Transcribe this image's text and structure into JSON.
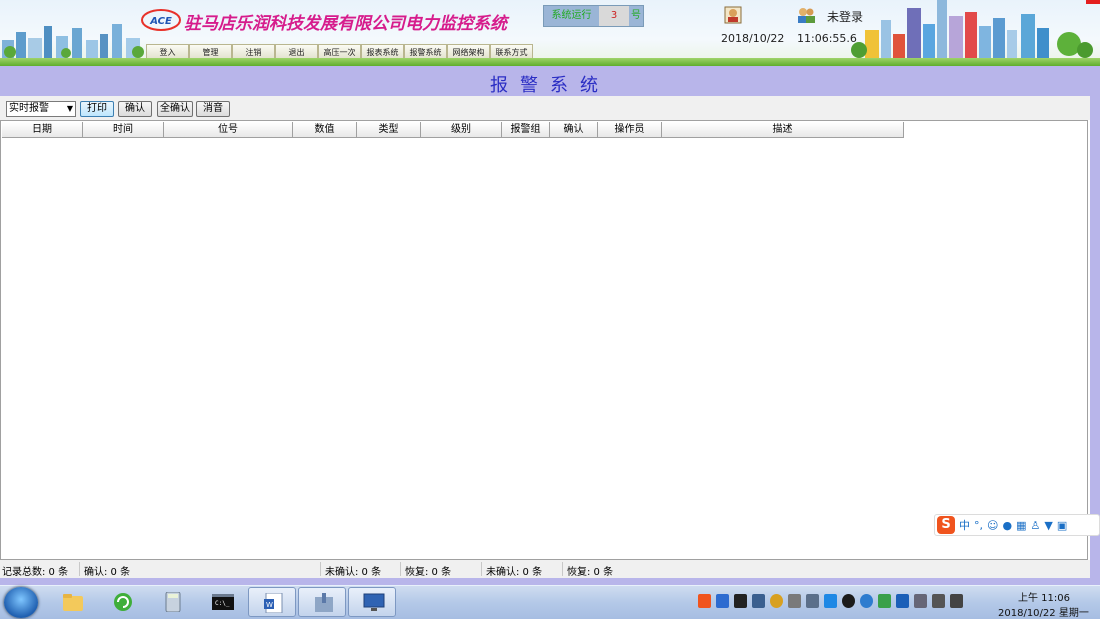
{
  "header": {
    "company_title": "驻马店乐润科技发展有限公司电力监控系统",
    "logo_text": "ACE",
    "nav": [
      {
        "label": "登入"
      },
      {
        "label": "管理"
      },
      {
        "label": "注销"
      },
      {
        "label": "退出"
      },
      {
        "label": "高压一次"
      },
      {
        "label": "报表系统"
      },
      {
        "label": "报警系统"
      },
      {
        "label": "网络架构"
      },
      {
        "label": "联系方式"
      }
    ],
    "status_label": "系统运行",
    "status_count": "3",
    "status_end": "号",
    "login_status": "未登录",
    "date": "2018/10/22",
    "time": "11:06:55.6"
  },
  "page_title": "报警系统",
  "toolbar": {
    "mode_selected": "实时报警",
    "print_label": "打印",
    "confirm_label": "确认",
    "confirm_all_label": "全确认",
    "mute_label": "消音"
  },
  "table": {
    "columns": [
      {
        "label": "日期"
      },
      {
        "label": "时间"
      },
      {
        "label": "位号"
      },
      {
        "label": "数值"
      },
      {
        "label": "类型"
      },
      {
        "label": "级别"
      },
      {
        "label": "报警组"
      },
      {
        "label": "确认"
      },
      {
        "label": "操作员"
      },
      {
        "label": "描述"
      }
    ],
    "rows": []
  },
  "statusbar": {
    "total": "记录总数: 0 条",
    "confirmed": "确认: 0 条",
    "unconfirmed_1": "未确认: 0 条",
    "recovered_1": "恢复: 0 条",
    "unconfirmed_2": "未确认: 0 条",
    "recovered_2": "恢复: 0 条"
  },
  "ime": {
    "mode": "中",
    "punct": "°,"
  },
  "taskbar": {
    "apps": [
      {
        "name": "explorer-icon"
      },
      {
        "name": "refresh-icon"
      },
      {
        "name": "calculator-icon"
      },
      {
        "name": "cmd-icon"
      },
      {
        "name": "word-icon"
      },
      {
        "name": "installer-icon"
      },
      {
        "name": "monitor-app-icon"
      }
    ],
    "clock_time": "上午 11:06",
    "clock_date": "2018/10/22 星期一"
  },
  "colors": {
    "title_band": "#b8b5ea",
    "title_text": "#2b2ec4",
    "company_title": "#d61c8c"
  }
}
